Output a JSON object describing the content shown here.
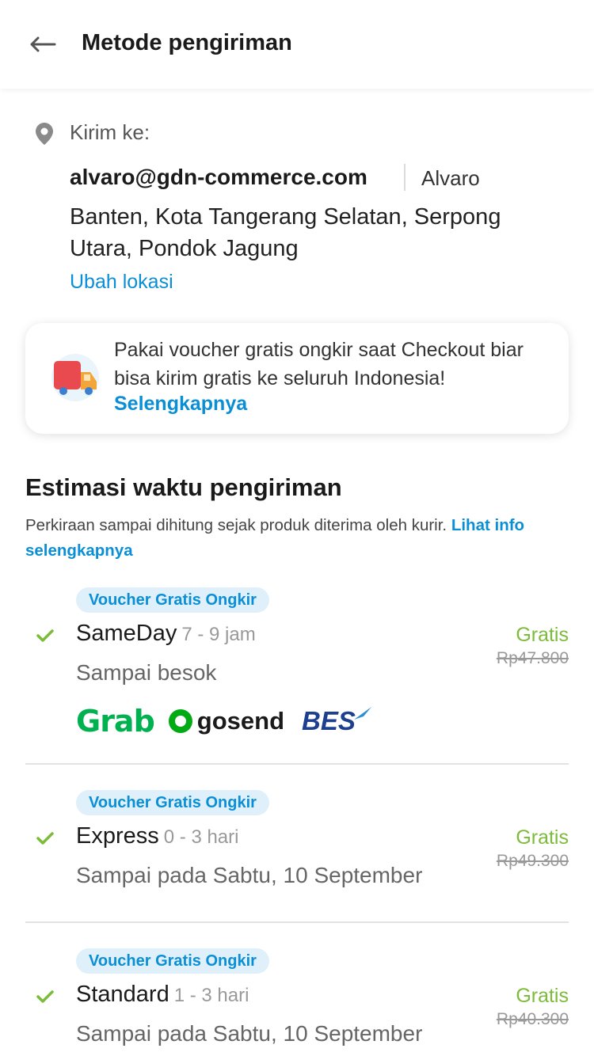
{
  "header": {
    "title": "Metode pengiriman"
  },
  "address": {
    "send_to_label": "Kirim ke:",
    "email": "alvaro@gdn-commerce.com",
    "name": "Alvaro",
    "line": "Banten, Kota Tangerang Selatan, Serpong Utara, Pondok Jagung",
    "change_link": "Ubah lokasi"
  },
  "promo": {
    "text": "Pakai voucher gratis ongkir saat Checkout biar bisa kirim gratis ke seluruh Indonesia!",
    "link": "Selengkapnya"
  },
  "estimate": {
    "title": "Estimasi waktu pengiriman",
    "desc": "Perkiraan sampai dihitung sejak produk diterima oleh kurir.",
    "link": "Lihat info selengkapnya"
  },
  "options": [
    {
      "badge": "Voucher Gratis Ongkir",
      "name": "SameDay",
      "time": "7 - 9 jam",
      "sub": "Sampai besok",
      "price": "Gratis",
      "old_price": "Rp47.800",
      "couriers": [
        "Grab",
        "gosend",
        "BES"
      ]
    },
    {
      "badge": "Voucher Gratis Ongkir",
      "name": "Express",
      "time": "0 - 3 hari",
      "sub": "Sampai pada Sabtu, 10 September",
      "price": "Gratis",
      "old_price": "Rp49.300"
    },
    {
      "badge": "Voucher Gratis Ongkir",
      "name": "Standard",
      "time": "1 - 3 hari",
      "sub": "Sampai pada Sabtu, 10 September",
      "price": "Gratis",
      "old_price": "Rp40.300"
    }
  ],
  "colors": {
    "accent_blue": "#0a8fd6",
    "green": "#7cbc3a",
    "badge_bg": "#dff0fb"
  }
}
